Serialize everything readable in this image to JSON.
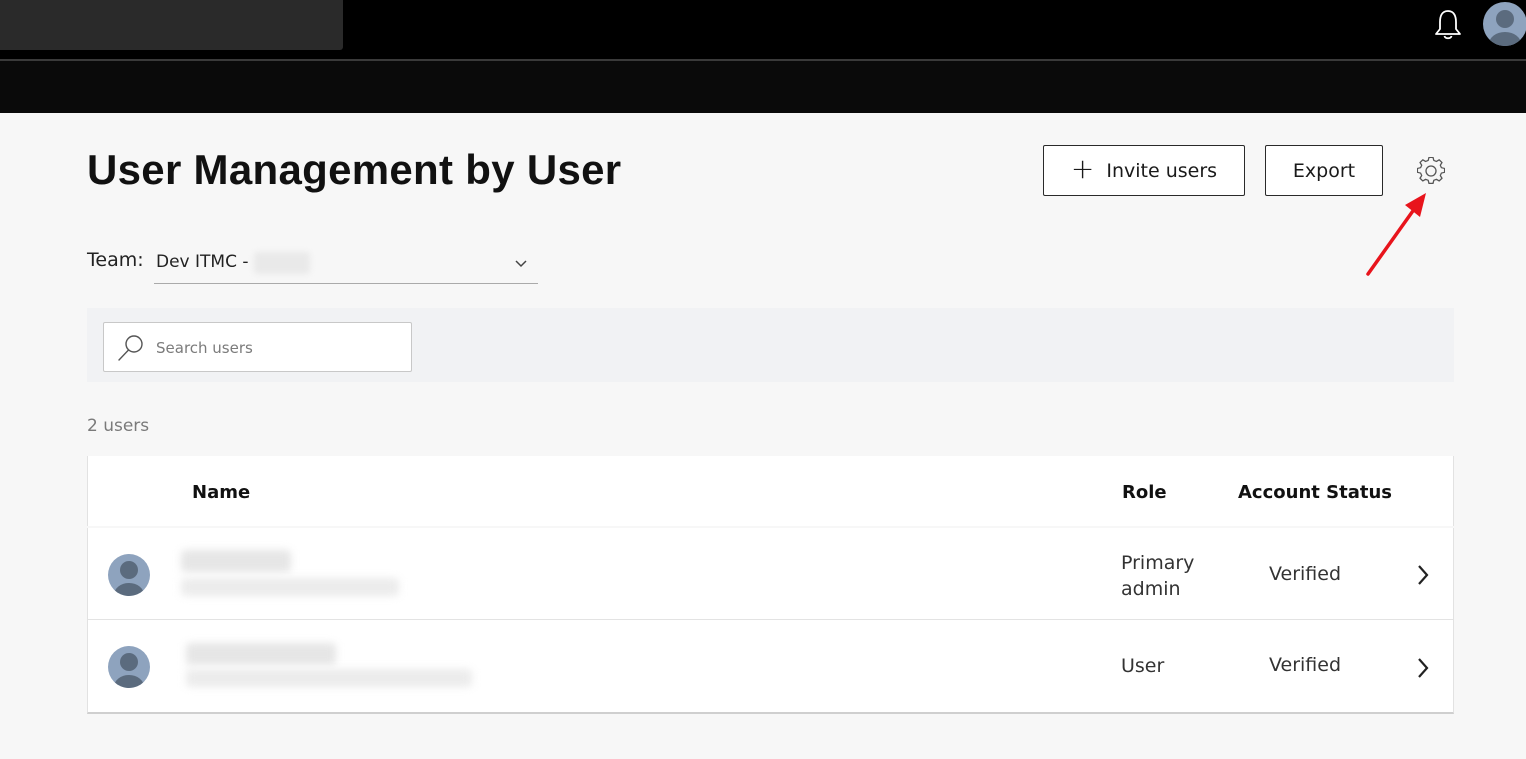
{
  "header": {
    "page_title": "User Management by User",
    "invite_label": "Invite users",
    "invite_icon": "plus-icon",
    "export_label": "Export",
    "settings_icon": "gear-icon",
    "notifications_icon": "bell-icon"
  },
  "team_filter": {
    "label": "Team:",
    "value": "Dev ITMC -"
  },
  "search": {
    "placeholder": "Search users",
    "value": ""
  },
  "users_summary": {
    "count_text": "2 users"
  },
  "table": {
    "columns": [
      "Name",
      "Role",
      "Account Status"
    ],
    "rows": [
      {
        "role": "Primary admin",
        "status": "Verified"
      },
      {
        "role": "User",
        "status": "Verified"
      }
    ]
  },
  "colors": {
    "topbar": "#000000",
    "page_background": "#f7f7f7",
    "annotation_arrow": "#e8141c"
  }
}
